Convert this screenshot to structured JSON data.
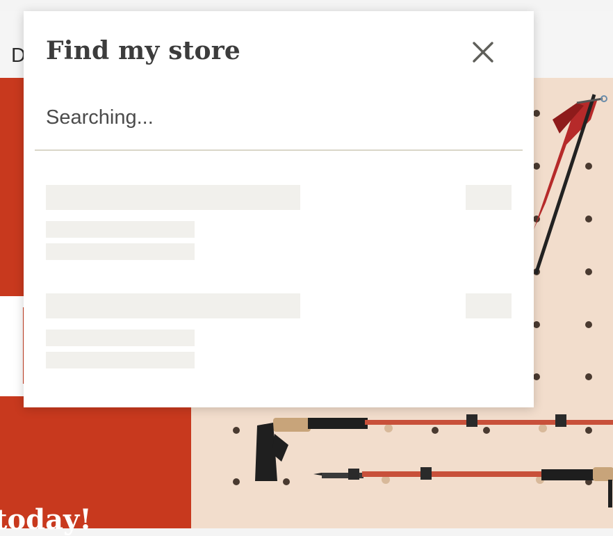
{
  "modal": {
    "title": "Find my store",
    "close_icon": "close-icon",
    "search_status": "Searching..."
  },
  "background": {
    "nav_partial_text": "D",
    "hero_text": "today!",
    "colors": {
      "brand_red": "#c8391e",
      "pegboard": "#f2ddcc",
      "skeleton": "#f1f0ec",
      "divider": "#d9d6c8"
    }
  },
  "skeleton_results": [
    {
      "state": "loading"
    },
    {
      "state": "loading"
    }
  ]
}
